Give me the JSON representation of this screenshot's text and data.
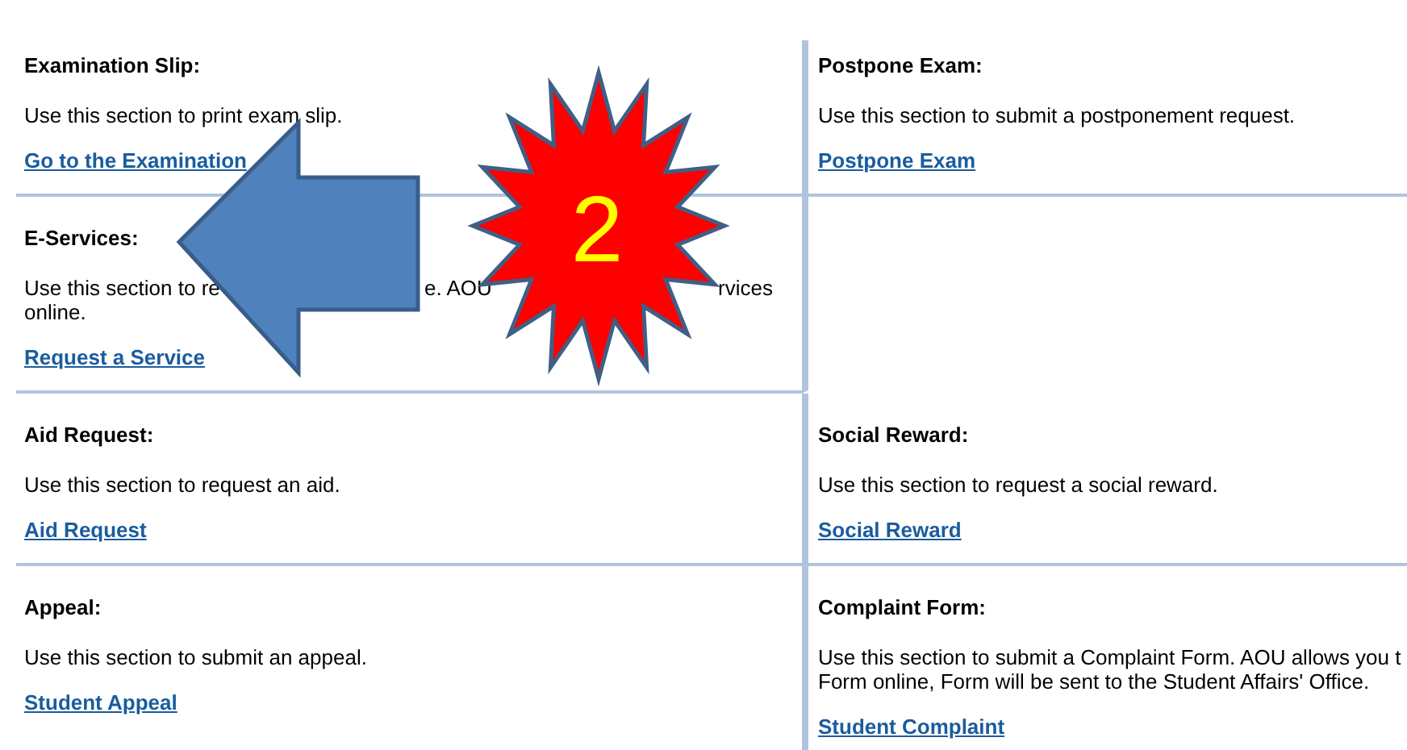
{
  "rows": [
    {
      "cells": [
        {
          "kind": "section",
          "title": "Examination Slip:",
          "description": [
            [
              "Use this section to print exam slip."
            ]
          ],
          "link": "Go to the Examination"
        },
        {
          "kind": "section",
          "title": "Postpone Exam:",
          "description": [
            [
              "Use this section to submit a postponement request."
            ]
          ],
          "link": "Postpone Exam"
        }
      ]
    },
    {
      "cells": [
        {
          "kind": "covered",
          "title": "E-Services:",
          "description": [
            [
              "Use this section to re",
              "e. AOU",
              "rvices"
            ],
            [
              "online."
            ]
          ],
          "link": "Request a Service"
        },
        {
          "kind": "empty"
        }
      ]
    },
    {
      "cells": [
        {
          "kind": "section",
          "title": "Aid Request:",
          "description": [
            [
              "Use this section to request an aid."
            ]
          ],
          "link": "Aid Request"
        },
        {
          "kind": "section",
          "title": "Social Reward:",
          "description": [
            [
              "Use this section to request a social reward."
            ]
          ],
          "link": "Social Reward"
        }
      ]
    },
    {
      "cells": [
        {
          "kind": "section",
          "title": "Appeal:",
          "description": [
            [
              "Use this section to submit an appeal."
            ]
          ],
          "link": "Student Appeal"
        },
        {
          "kind": "section",
          "title": "Complaint Form:",
          "description": [
            [
              "Use this section to submit a Complaint Form. AOU allows you t"
            ],
            [
              "Form online, Form will be sent to the Student Affairs' Office."
            ]
          ],
          "link": "Student Complaint"
        }
      ]
    }
  ],
  "callout": {
    "label": "2"
  }
}
